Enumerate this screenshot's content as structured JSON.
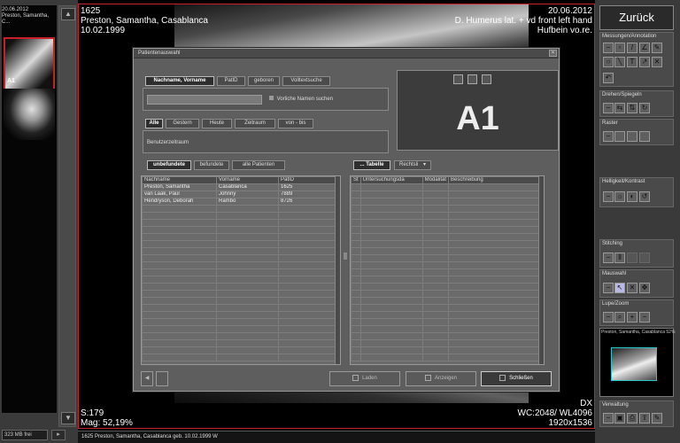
{
  "left_strip": {
    "thumb_date": "20.06.2012",
    "thumb_name": "Preston, Samantha, C...",
    "thumb_label": "A1",
    "status_text": "323 MB frei",
    "status_btn": "▸"
  },
  "overlay": {
    "top_left": [
      "1625",
      "Preston, Samantha, Casablanca",
      "10.02.1999"
    ],
    "top_right": [
      "20.06.2012",
      "D. Humerus lat. + vd front left hand",
      "Hufbein vo.re."
    ],
    "bottom_left": [
      "S:179",
      "Mag: 52,19%"
    ],
    "bottom_right": [
      "DX",
      "WC:2048/ WL4096",
      "1920x1536"
    ]
  },
  "dialog": {
    "title": "Patientenauswahl",
    "close": "×",
    "search_tabs": [
      "Nachname, Vorname",
      "PatID",
      "geboren",
      "Volltextsuche"
    ],
    "checkbox_label": "Vorliche Namen suchen",
    "date_tabs": [
      "Alle",
      "Gestern",
      "Heute",
      "Zeitraum",
      "von - bis"
    ],
    "range_label": "Benutzerzeitraum",
    "preview_label": "A1",
    "list_tabs": [
      "unbefundete",
      "befundete",
      "alle Patienten"
    ],
    "patient_columns": [
      "Nachname",
      "Vorname",
      "PatID"
    ],
    "patients": [
      [
        "Preston, Samantha",
        "Casablanca",
        "1625"
      ],
      [
        "van Laak, Paul",
        "Johnny",
        "7889"
      ],
      [
        "Hendryson, Deborah",
        "Rambo",
        "8726"
      ]
    ],
    "exam_tabs": [
      "... Tabelle",
      "Rechtsli"
    ],
    "exam_columns": [
      "St",
      "Untersuchungsda",
      "Modalität",
      "Beschreibung"
    ],
    "buttons": {
      "laden": "Laden",
      "anzeigen": "Anzeigen",
      "schliessen": "Schließen"
    }
  },
  "right_panel": {
    "back_label": "Zurück",
    "groups": [
      "Messungen/Annotation",
      "Drehen/Spiegeln",
      "Raster",
      "Helligkeit/Kontrast",
      "Stitching",
      "Mauswahl",
      "Lupe/Zoom",
      "Verwaltung"
    ],
    "mini_head": "Preston, Samantha, Casablanca 52%"
  },
  "bottom_bar": {
    "text": "1625 Preston, Samantha, Casablanca geb. 10.02.1999 W"
  }
}
